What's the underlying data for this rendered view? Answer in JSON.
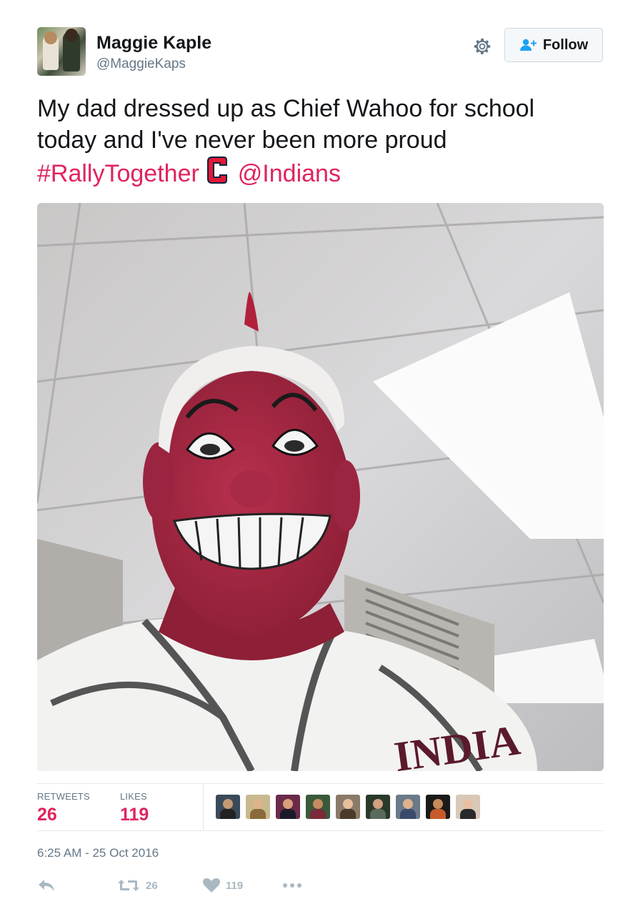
{
  "user": {
    "name": "Maggie Kaple",
    "handle": "@MaggieKaps"
  },
  "follow": {
    "label": "Follow"
  },
  "tweet": {
    "line1": "My dad dressed up as Chief Wahoo for school",
    "line2": "today and I've never been more proud",
    "hashtag": "#RallyTogether",
    "mention": "@Indians"
  },
  "stats": {
    "retweets_label": "RETWEETS",
    "retweets": "26",
    "likes_label": "LIKES",
    "likes": "119"
  },
  "timestamp": "6:25 AM - 25 Oct 2016",
  "actions": {
    "retweet_count": "26",
    "like_count": "119"
  },
  "icons": [
    "gear-icon",
    "follow-person-icon",
    "cleveland-c-logo-icon",
    "reply-icon",
    "retweet-icon",
    "heart-icon",
    "more-icon"
  ],
  "colors": {
    "accent": "#e0245e",
    "secondary_text": "#657786",
    "icon_gray": "#aab8c2"
  }
}
